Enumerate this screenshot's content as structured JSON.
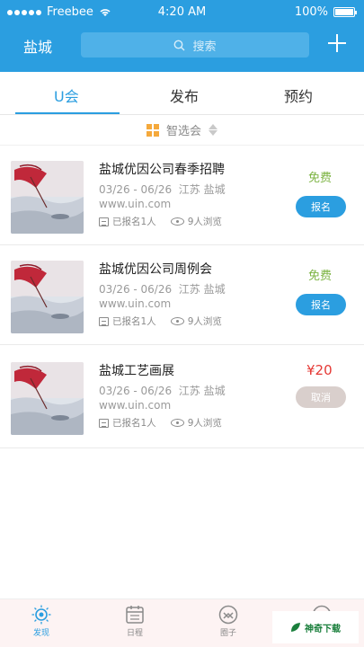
{
  "status_bar": {
    "carrier": "Freebee",
    "time": "4:20 AM",
    "battery": "100%"
  },
  "header": {
    "city": "盐城",
    "search_placeholder": "搜索"
  },
  "tabs": [
    {
      "label": "U会",
      "active": true
    },
    {
      "label": "发布",
      "active": false
    },
    {
      "label": "预约",
      "active": false
    }
  ],
  "filter": {
    "label": "智选会"
  },
  "events": [
    {
      "title": "盐城优因公司春季招聘",
      "dates": "03/26 - 06/26",
      "location": "江苏 盐城",
      "url": "www.uin.com",
      "signed": "已报名1人",
      "views": "9人浏览",
      "price": "免费",
      "price_type": "free",
      "button": "报名",
      "button_type": "signup"
    },
    {
      "title": "盐城优因公司周例会",
      "dates": "03/26 - 06/26",
      "location": "江苏 盐城",
      "url": "www.uin.com",
      "signed": "已报名1人",
      "views": "9人浏览",
      "price": "免费",
      "price_type": "free",
      "button": "报名",
      "button_type": "signup"
    },
    {
      "title": "盐城工艺画展",
      "dates": "03/26 - 06/26",
      "location": "江苏 盐城",
      "url": "www.uin.com",
      "signed": "已报名1人",
      "views": "9人浏览",
      "price": "¥20",
      "price_type": "paid",
      "button": "取消",
      "button_type": "cancel"
    }
  ],
  "tab_bar": [
    {
      "label": "发现",
      "icon": "discover-icon",
      "active": true
    },
    {
      "label": "日程",
      "icon": "calendar-icon",
      "active": false
    },
    {
      "label": "圈子",
      "icon": "circle-icon",
      "active": false
    },
    {
      "label": "",
      "icon": "profile-icon",
      "active": false
    }
  ],
  "watermark": {
    "text": "神奇下载"
  },
  "colors": {
    "primary": "#2b9ee0",
    "free": "#7cb342",
    "paid": "#e53935",
    "cancel": "#d9cfcc"
  }
}
